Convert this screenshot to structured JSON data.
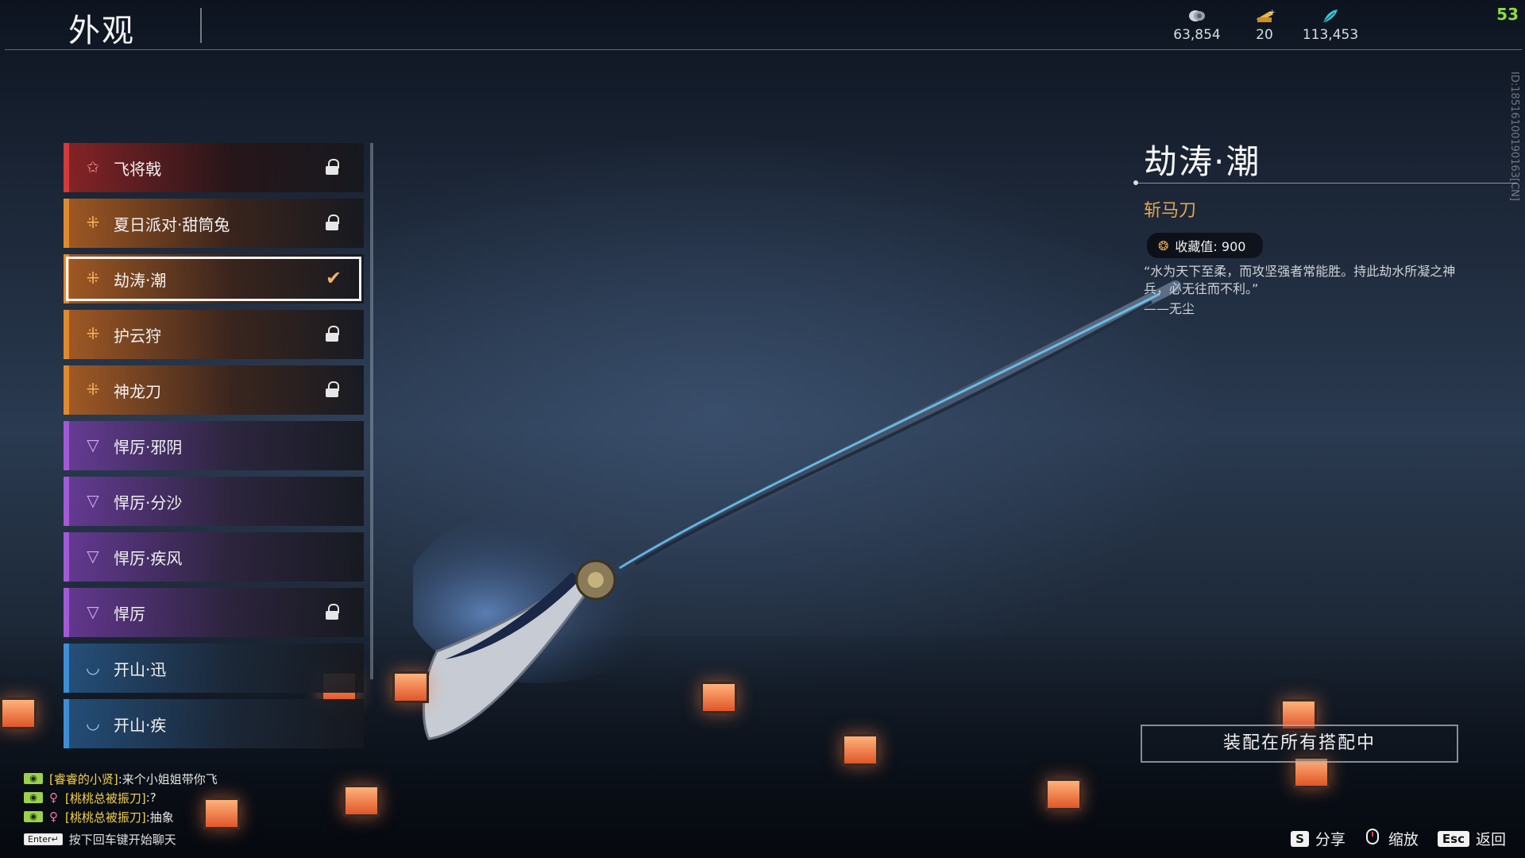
{
  "header": {
    "title": "外观",
    "fps": "53",
    "currencies": [
      {
        "icon": "coin-stack-icon",
        "value": "63,854"
      },
      {
        "icon": "ticket-icon",
        "value": "20"
      },
      {
        "icon": "feather-icon",
        "value": "113,453"
      }
    ],
    "player_id": "ID:18516100190163[CN]"
  },
  "list": {
    "items": [
      {
        "label": "飞将戟",
        "quality": "red",
        "state": "locked"
      },
      {
        "label": "夏日派对·甜筒兔",
        "quality": "orange",
        "state": "locked"
      },
      {
        "label": "劫涛·潮",
        "quality": "orange",
        "state": "selected"
      },
      {
        "label": "护云狩",
        "quality": "orange",
        "state": "locked"
      },
      {
        "label": "神龙刀",
        "quality": "orange",
        "state": "locked"
      },
      {
        "label": "悍厉·邪阴",
        "quality": "purple",
        "state": "none"
      },
      {
        "label": "悍厉·分沙",
        "quality": "purple",
        "state": "none"
      },
      {
        "label": "悍厉·疾风",
        "quality": "purple",
        "state": "none"
      },
      {
        "label": "悍厉",
        "quality": "purple",
        "state": "locked"
      },
      {
        "label": "开山·迅",
        "quality": "blue",
        "state": "none"
      },
      {
        "label": "开山·疾",
        "quality": "blue",
        "state": "none"
      }
    ]
  },
  "detail": {
    "name": "劫涛·潮",
    "type": "斩马刀",
    "collection_label": "收藏值: 900",
    "quote": "“水为天下至柔，而攻坚强者常能胜。持此劫水所凝之神兵，必无往而不利。”",
    "author": "——无尘",
    "equip_button": "装配在所有搭配中"
  },
  "chat": {
    "messages": [
      {
        "name": "[睿睿的小贤]",
        "text": ":来个小姐姐带你飞",
        "gender": ""
      },
      {
        "name": "[桃桃总被振刀]",
        "text": ":?",
        "gender": "♀"
      },
      {
        "name": "[桃桃总被振刀]",
        "text": ":抽象",
        "gender": "♀"
      }
    ],
    "enter_key": "Enter↵",
    "hint": "按下回车键开始聊天"
  },
  "hints": [
    {
      "key": "S",
      "label": "分享"
    },
    {
      "key": "",
      "label": "缩放"
    },
    {
      "key": "Esc",
      "label": "返回"
    }
  ],
  "colors": {
    "red": "#d33b3b",
    "orange": "#e08a2e",
    "purple": "#a25ad6",
    "blue": "#3d8fd6",
    "accent_gold": "#e3a64f"
  }
}
